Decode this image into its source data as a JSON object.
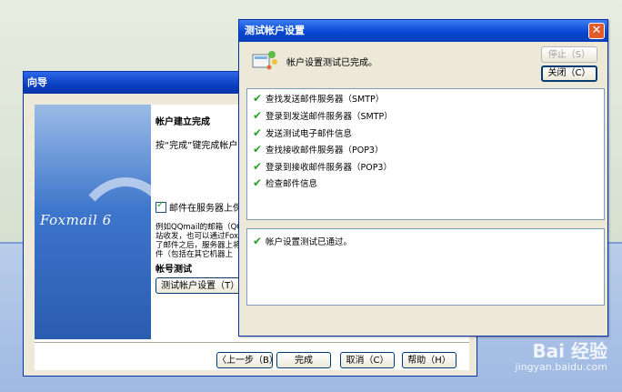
{
  "wizard": {
    "title": "向导",
    "brand": "Foxmail 6",
    "heading": "帐户建立完成",
    "instruction": "按“完成”键完成帐户建",
    "checkbox_label": "邮件在服务器上保留",
    "para_lines": [
      "例如QQmail的邮箱（QQ号",
      "站收发，也可以通过Fox",
      "了邮件之后，服务器上将",
      "件（包括在其它机器上"
    ],
    "test_heading": "帐号测试",
    "test_button": "测试帐户设置（T）...",
    "back_button": "〈上一步（B）",
    "finish_button": "完成",
    "cancel_button": "取消（C）",
    "help_button": "帮助（H）"
  },
  "dialog": {
    "title": "测试帐户设置",
    "close_glyph": "✕",
    "status": "帐户设置测试已完成。",
    "stop_button": "停止（S）",
    "close_button": "关闭（C）",
    "steps": [
      "查找发送邮件服务器（SMTP）",
      "登录到发送邮件服务器（SMTP）",
      "发送测试电子邮件信息",
      "查找接收邮件服务器（POP3）",
      "登录到接收邮件服务器（POP3）",
      "检查邮件信息"
    ],
    "result": "帐户设置测试已通过。"
  },
  "watermark": {
    "logo": "Bai 经验",
    "url": "jingyan.baidu.com"
  }
}
